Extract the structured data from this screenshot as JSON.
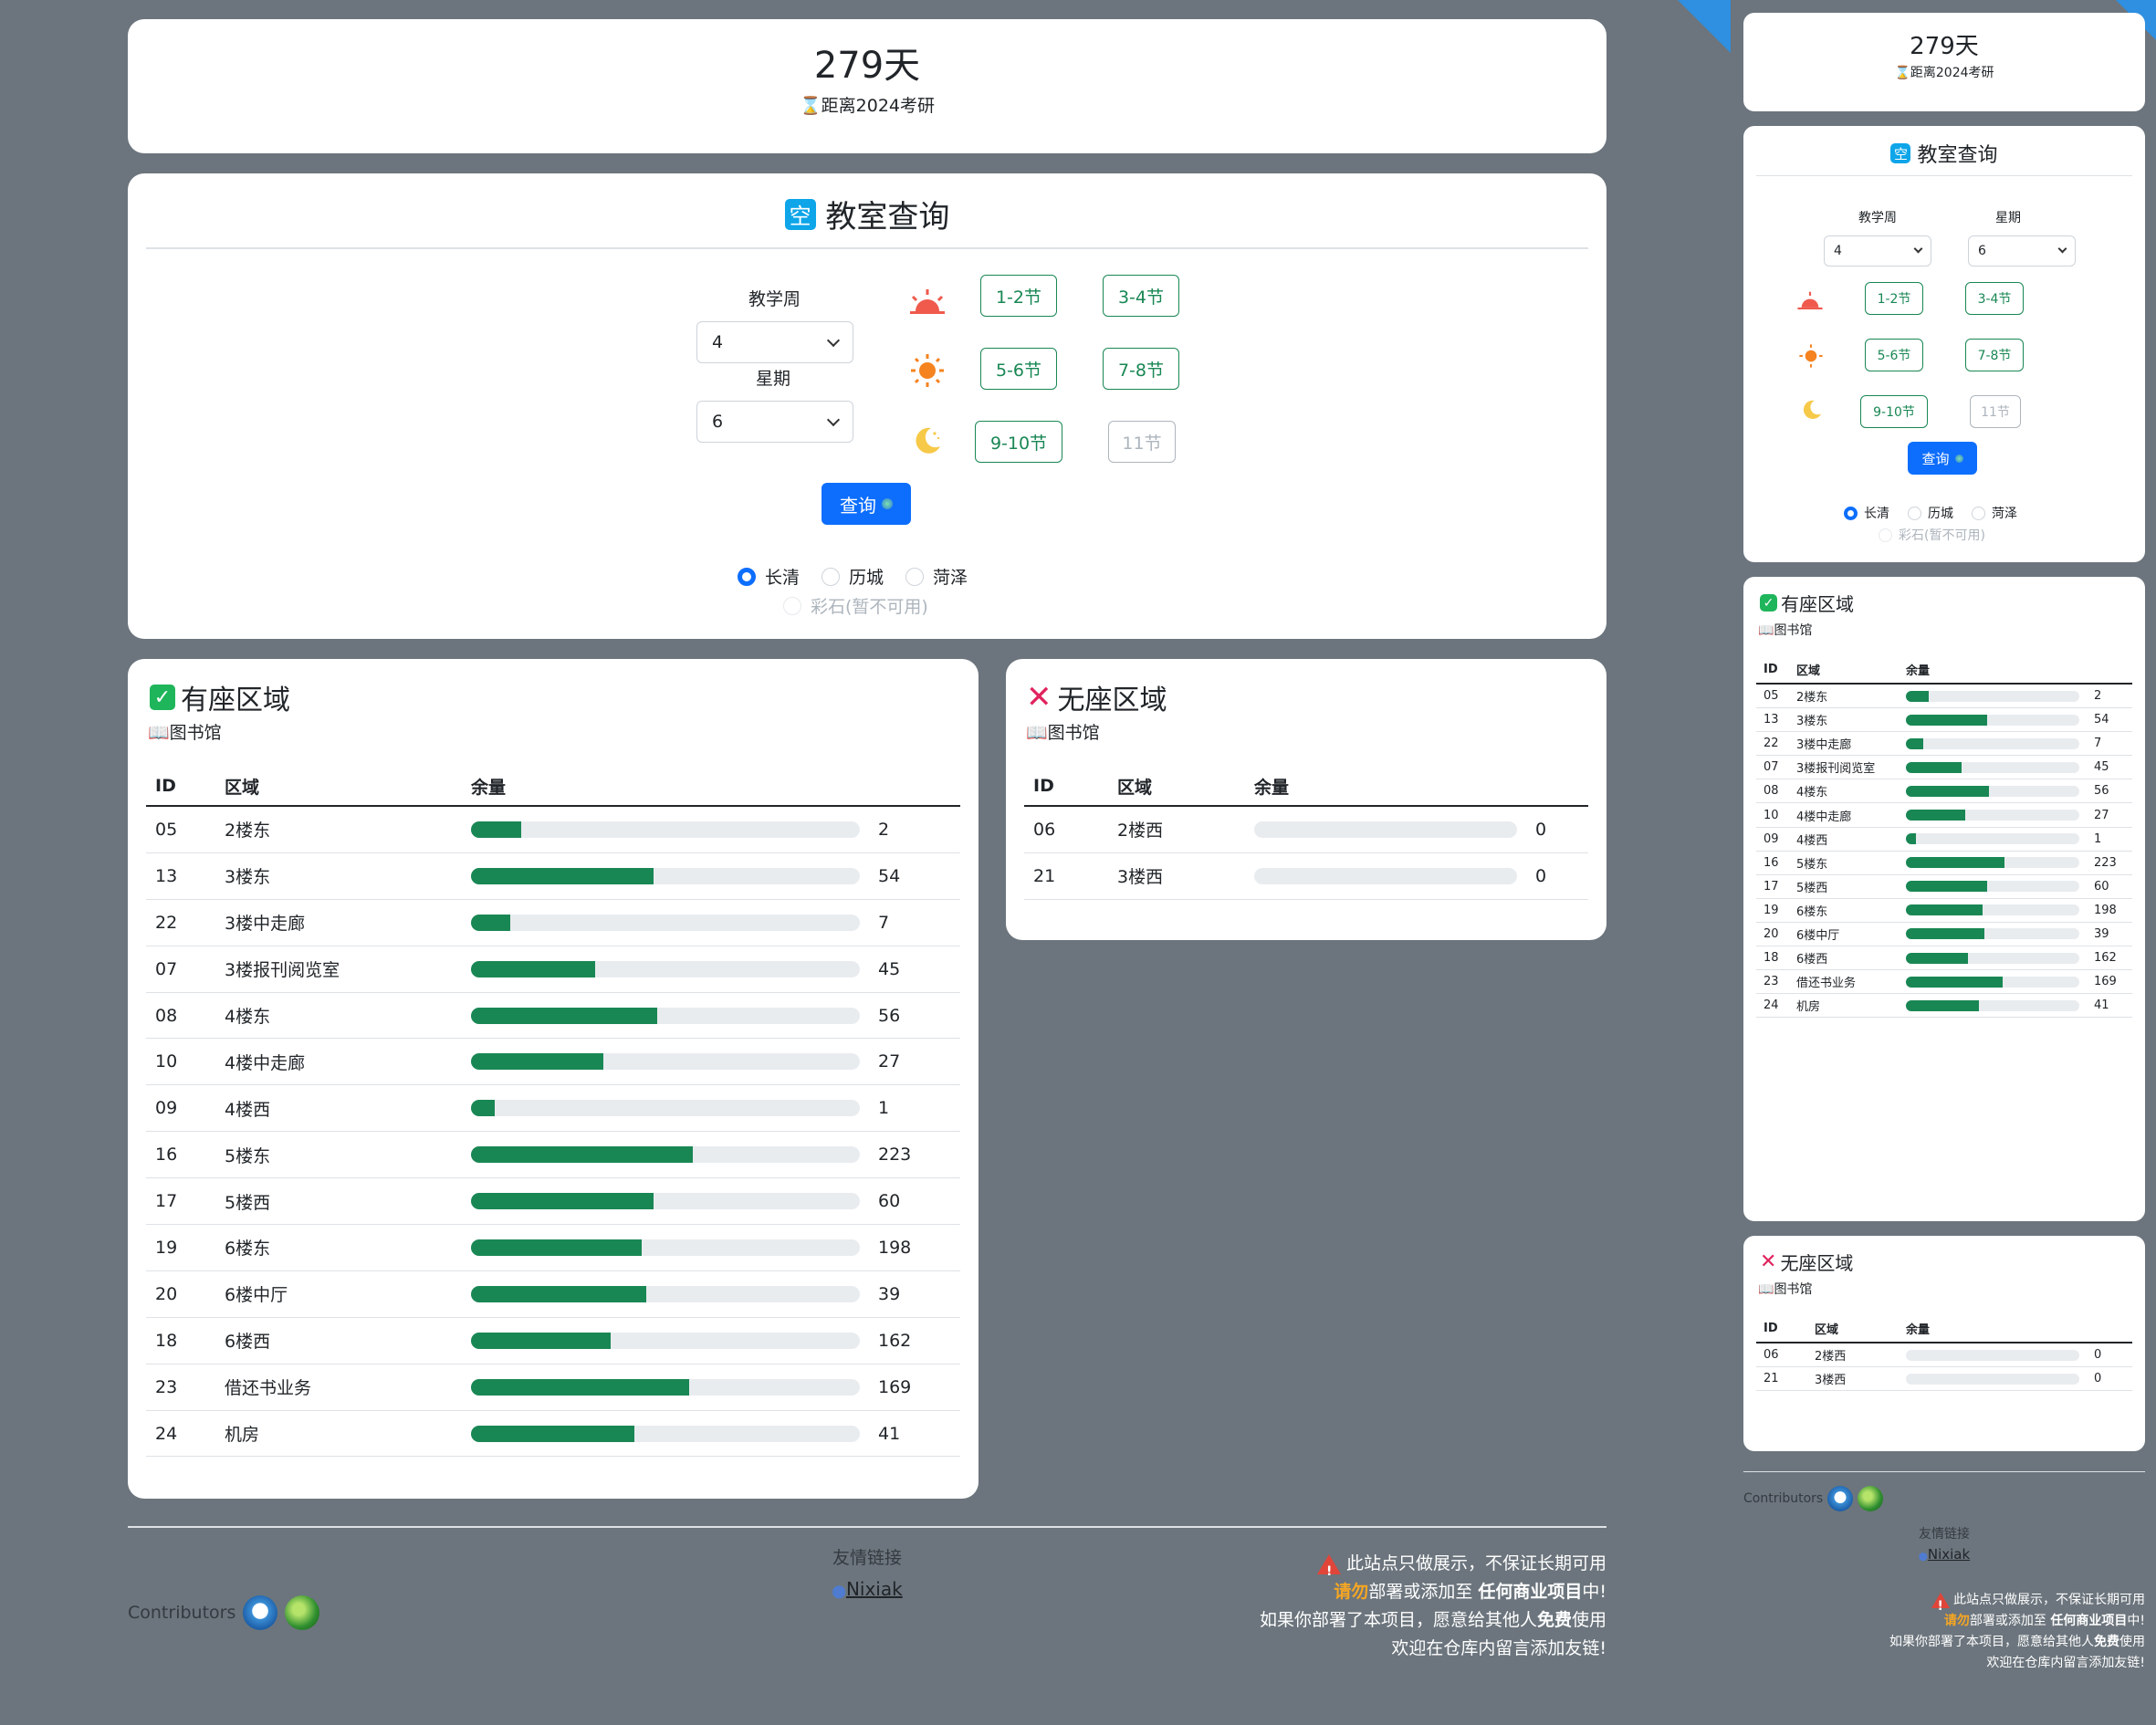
{
  "countdown": {
    "days": "279天",
    "label": "距离2024考研",
    "icon": "hourglass-icon"
  },
  "query": {
    "title": "教室查询",
    "icon_char": "空",
    "week_label": "教学周",
    "week_value": "4",
    "day_label": "星期",
    "day_value": "6",
    "periods": [
      {
        "label": "1-2节",
        "enabled": true
      },
      {
        "label": "3-4节",
        "enabled": true
      },
      {
        "label": "5-6节",
        "enabled": true
      },
      {
        "label": "7-8节",
        "enabled": true
      },
      {
        "label": "9-10节",
        "enabled": true
      },
      {
        "label": "11节",
        "enabled": false
      }
    ],
    "button": "查询",
    "campuses": [
      {
        "label": "长清",
        "checked": true
      },
      {
        "label": "历城",
        "checked": false
      },
      {
        "label": "菏泽",
        "checked": false
      },
      {
        "label": "彩石(暂不可用)",
        "checked": false
      }
    ]
  },
  "available": {
    "title": "有座区域",
    "subtitle": "图书馆",
    "headers": [
      "ID",
      "区域",
      "余量"
    ],
    "rows": [
      {
        "id": "05",
        "area": "2楼东",
        "count": "2",
        "pct": 0.13
      },
      {
        "id": "13",
        "area": "3楼东",
        "count": "54",
        "pct": 0.47
      },
      {
        "id": "22",
        "area": "3楼中走廊",
        "count": "7",
        "pct": 0.1
      },
      {
        "id": "07",
        "area": "3楼报刊阅览室",
        "count": "45",
        "pct": 0.32
      },
      {
        "id": "08",
        "area": "4楼东",
        "count": "56",
        "pct": 0.48
      },
      {
        "id": "10",
        "area": "4楼中走廊",
        "count": "27",
        "pct": 0.34
      },
      {
        "id": "09",
        "area": "4楼西",
        "count": "1",
        "pct": 0.06
      },
      {
        "id": "16",
        "area": "5楼东",
        "count": "223",
        "pct": 0.57
      },
      {
        "id": "17",
        "area": "5楼西",
        "count": "60",
        "pct": 0.47
      },
      {
        "id": "19",
        "area": "6楼东",
        "count": "198",
        "pct": 0.44
      },
      {
        "id": "20",
        "area": "6楼中厅",
        "count": "39",
        "pct": 0.45
      },
      {
        "id": "18",
        "area": "6楼西",
        "count": "162",
        "pct": 0.36
      },
      {
        "id": "23",
        "area": "借还书业务",
        "count": "169",
        "pct": 0.56
      },
      {
        "id": "24",
        "area": "机房",
        "count": "41",
        "pct": 0.42
      }
    ]
  },
  "unavailable": {
    "title": "无座区域",
    "subtitle": "图书馆",
    "headers": [
      "ID",
      "区域",
      "余量"
    ],
    "rows": [
      {
        "id": "06",
        "area": "2楼西",
        "count": "0",
        "pct": 0
      },
      {
        "id": "21",
        "area": "3楼西",
        "count": "0",
        "pct": 0
      }
    ]
  },
  "footer": {
    "contributors_label": "Contributors",
    "links_title": "友情链接",
    "link_text": "Nixiak",
    "notice_line1": "此站点只做展示，不保证长期可用",
    "notice_line2_a": "请勿",
    "notice_line2_b": "部署或添加至 ",
    "notice_line2_c": "任何商业项目",
    "notice_line2_d": "中!",
    "notice_line3_a": "如果你部署了本项目，愿意给其他人",
    "notice_line3_b": "免费",
    "notice_line3_c": "使用",
    "notice_line4": "欢迎在仓库内留言添加友链!"
  },
  "colors": {
    "background": "#6c757d",
    "primary": "#0d6efd",
    "success": "#198754",
    "danger": "#e0245e",
    "warning": "#f5a623"
  }
}
